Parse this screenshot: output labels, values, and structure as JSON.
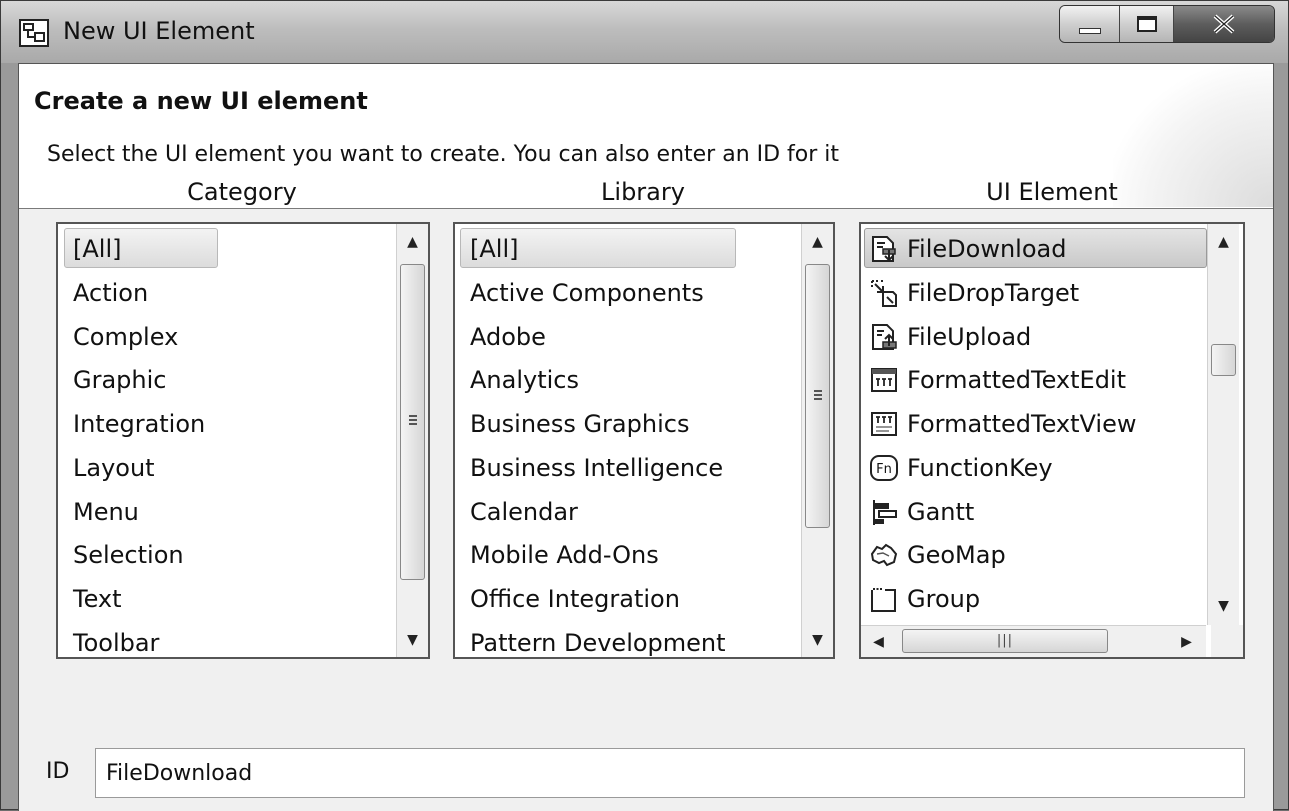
{
  "window": {
    "title": "New UI Element"
  },
  "header": {
    "title": "Create a new UI element",
    "description": "Select the UI element you want to create. You can also enter an ID for it"
  },
  "category": {
    "label": "Category",
    "items": [
      "[All]",
      "Action",
      "Complex",
      "Graphic",
      "Integration",
      "Layout",
      "Menu",
      "Selection",
      "Text",
      "Toolbar"
    ],
    "selected": "[All]"
  },
  "library": {
    "label": "Library",
    "items": [
      "[All]",
      "Active Components",
      "Adobe",
      "Analytics",
      "Business Graphics",
      "Business Intelligence",
      "Calendar",
      "Mobile Add-Ons",
      "Office Integration",
      "Pattern Development"
    ],
    "selected": "[All]"
  },
  "ui_element": {
    "label": "UI Element",
    "items": [
      {
        "label": "FileDownload",
        "icon": "file-download-icon"
      },
      {
        "label": "FileDropTarget",
        "icon": "file-drop-target-icon"
      },
      {
        "label": "FileUpload",
        "icon": "file-upload-icon"
      },
      {
        "label": "FormattedTextEdit",
        "icon": "formatted-text-edit-icon"
      },
      {
        "label": "FormattedTextView",
        "icon": "formatted-text-view-icon"
      },
      {
        "label": "FunctionKey",
        "icon": "function-key-icon"
      },
      {
        "label": "Gantt",
        "icon": "gantt-icon"
      },
      {
        "label": "GeoMap",
        "icon": "geo-map-icon"
      },
      {
        "label": "Group",
        "icon": "group-icon"
      }
    ],
    "selected": "FileDownload",
    "fn_icon_text": "Fn"
  },
  "id_field": {
    "label": "ID",
    "value": "FileDownload"
  }
}
